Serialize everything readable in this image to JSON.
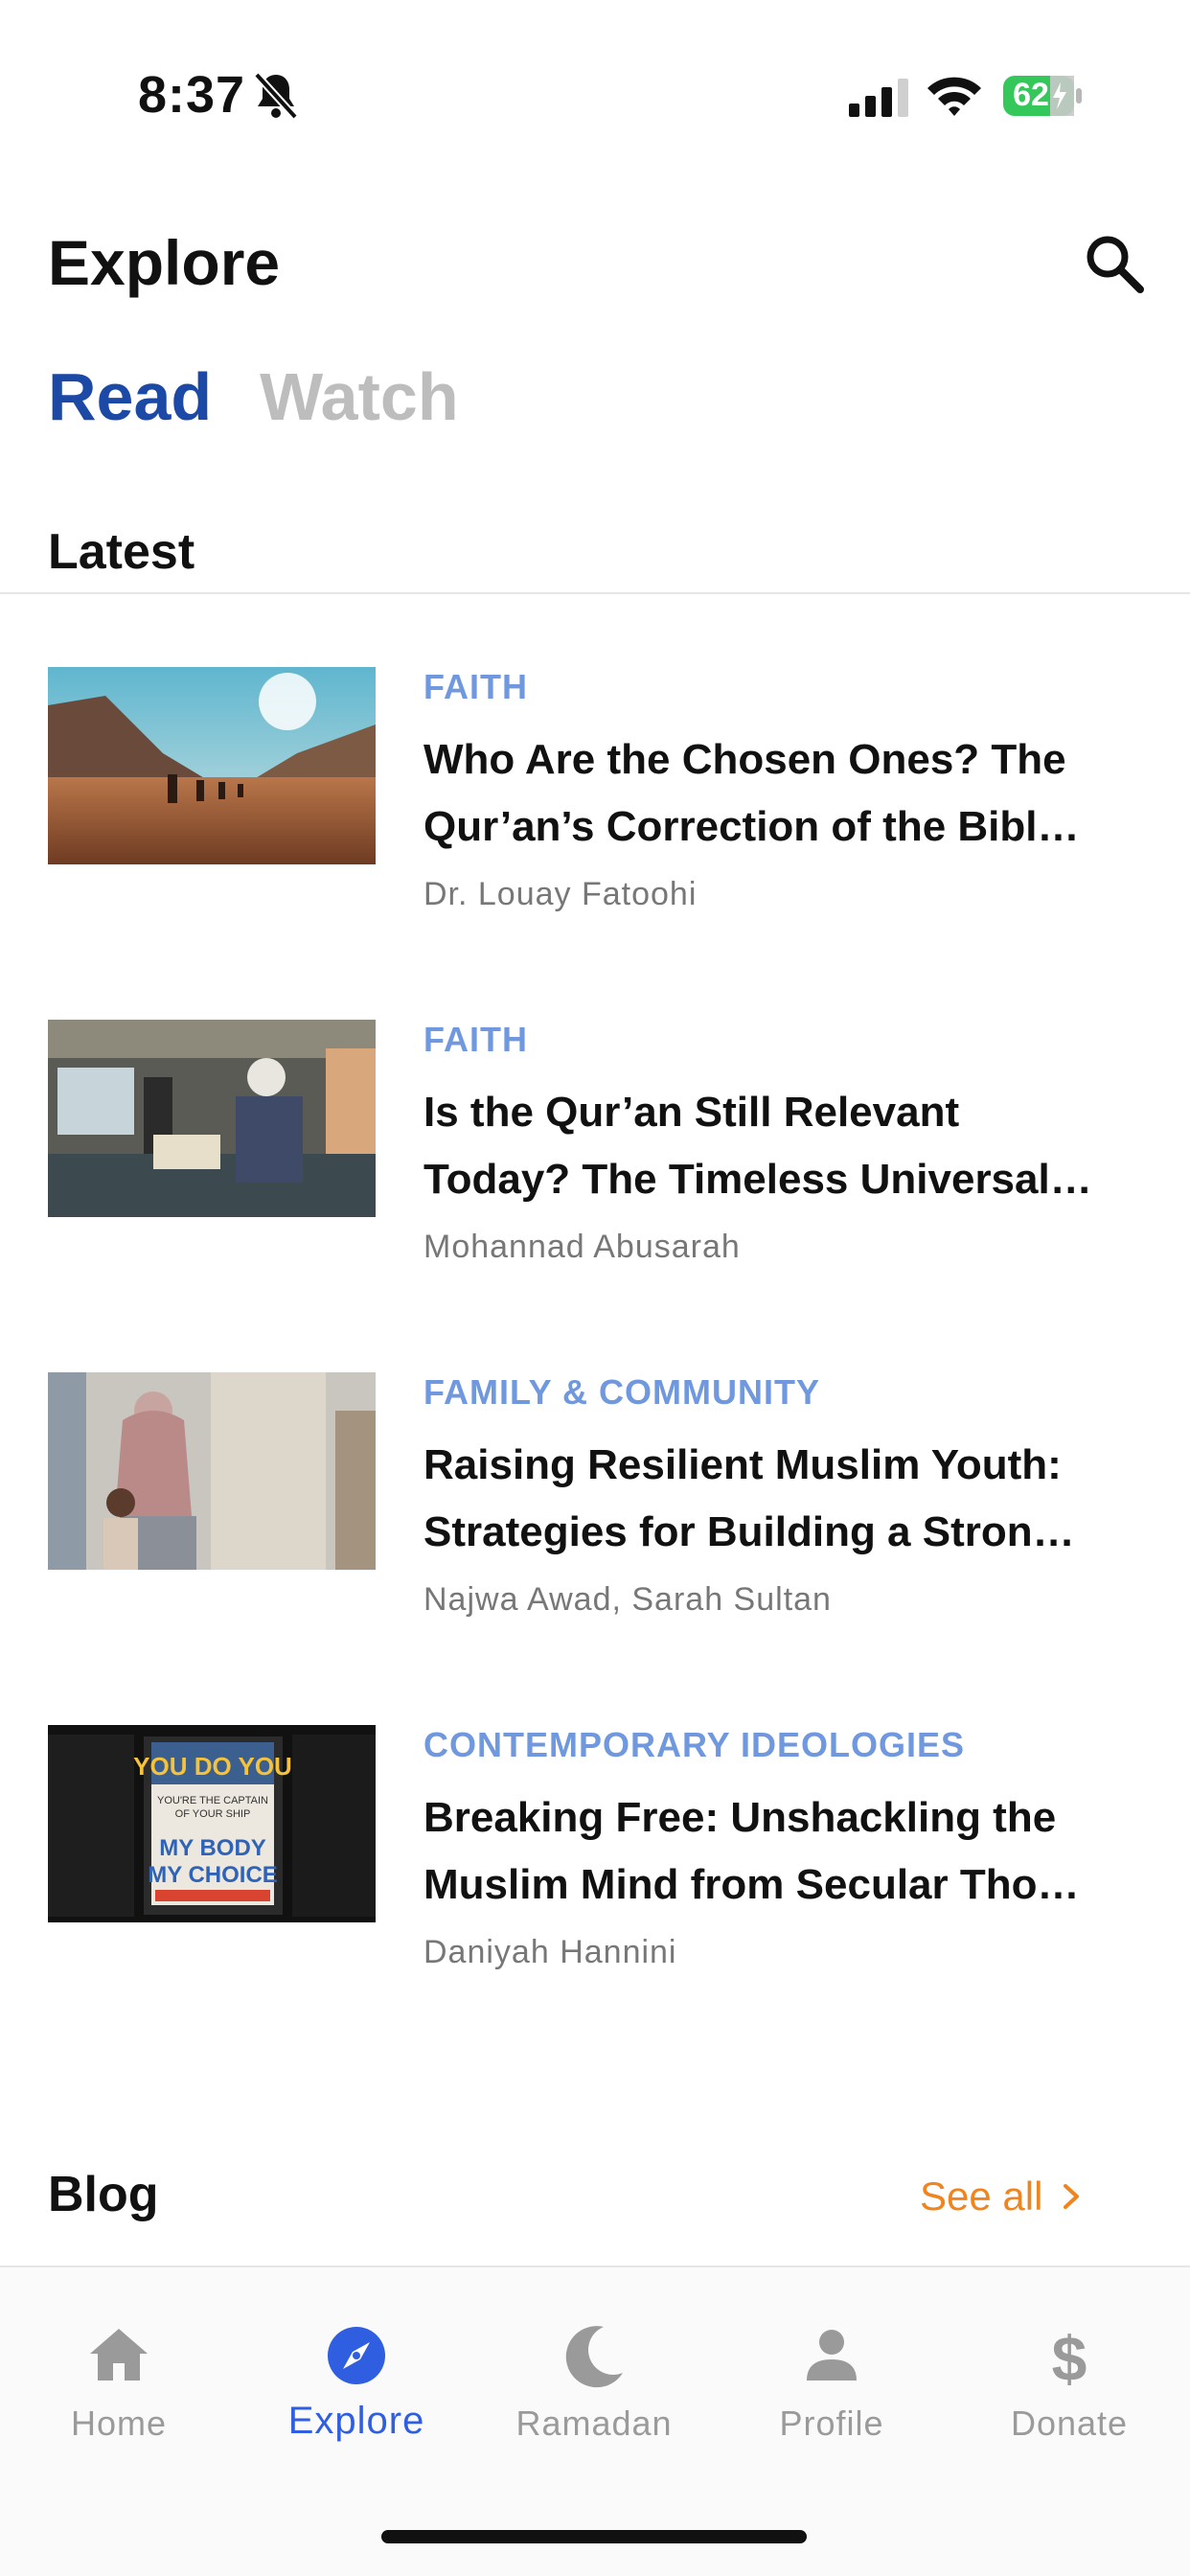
{
  "status_bar": {
    "time": "8:37",
    "battery_level": "62"
  },
  "header": {
    "title": "Explore"
  },
  "tabs": [
    {
      "label": "Read",
      "active": true
    },
    {
      "label": "Watch",
      "active": false
    }
  ],
  "latest": {
    "title": "Latest",
    "articles": [
      {
        "category": "FAITH",
        "title_lines": [
          "Who Are the Chosen Ones? The",
          "Qur’an’s Correction of the Bibl…"
        ],
        "author": "Dr. Louay Fatoohi"
      },
      {
        "category": "FAITH",
        "title_lines": [
          "Is the Qur’an Still Relevant",
          "Today? The Timeless Universal…"
        ],
        "author": "Mohannad Abusarah"
      },
      {
        "category": "FAMILY & COMMUNITY",
        "title_lines": [
          "Raising Resilient Muslim Youth:",
          "Strategies for Building a Stron…"
        ],
        "author": "Najwa Awad, Sarah Sultan"
      },
      {
        "category": "CONTEMPORARY IDEOLOGIES",
        "title_lines": [
          "Breaking Free: Unshackling the",
          "Muslim Mind from Secular Tho…"
        ],
        "author": "Daniyah Hannini"
      }
    ]
  },
  "thumb_text": {
    "poster_line1": "YOU DO YOU",
    "poster_line2": "YOU'RE THE CAPTAIN",
    "poster_line3": "OF YOUR SHIP",
    "poster_line4": "MY BODY",
    "poster_line5": "MY CHOICE"
  },
  "blog": {
    "title": "Blog",
    "see_all": "See all"
  },
  "bottom_nav": [
    {
      "label": "Home",
      "icon": "home-icon",
      "active": false
    },
    {
      "label": "Explore",
      "icon": "compass-icon",
      "active": true
    },
    {
      "label": "Ramadan",
      "icon": "moon-icon",
      "active": false
    },
    {
      "label": "Profile",
      "icon": "person-icon",
      "active": false
    },
    {
      "label": "Donate",
      "icon": "dollar-icon",
      "active": false
    }
  ],
  "colors": {
    "accent_blue": "#1d49a6",
    "category_blue": "#6f98de",
    "see_all_orange": "#f0851f",
    "nav_active": "#2f5fe0"
  }
}
